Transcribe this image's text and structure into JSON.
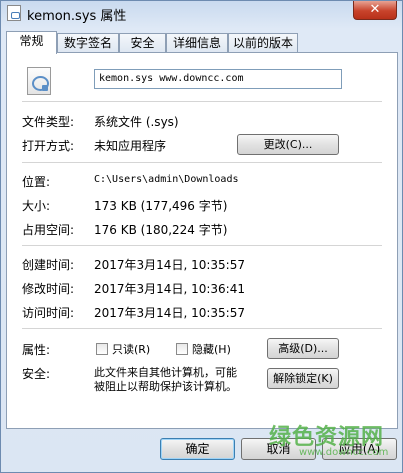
{
  "window": {
    "title": "kemon.sys 属性",
    "close_label": "✕"
  },
  "tabs": [
    {
      "label": "常规",
      "active": true
    },
    {
      "label": "数字签名",
      "active": false
    },
    {
      "label": "安全",
      "active": false
    },
    {
      "label": "详细信息",
      "active": false
    },
    {
      "label": "以前的版本",
      "active": false
    }
  ],
  "general": {
    "file_name": "kemon.sys www.downcc.com",
    "file_type_label": "文件类型:",
    "file_type_value": "系统文件 (.sys)",
    "open_with_label": "打开方式:",
    "open_with_value": "未知应用程序",
    "change_button": "更改(C)...",
    "location_label": "位置:",
    "location_value": "C:\\Users\\admin\\Downloads",
    "size_label": "大小:",
    "size_value": "173 KB (177,496 字节)",
    "disk_size_label": "占用空间:",
    "disk_size_value": "176 KB (180,224 字节)",
    "created_label": "创建时间:",
    "created_value": "2017年3月14日, 10:35:57",
    "modified_label": "修改时间:",
    "modified_value": "2017年3月14日, 10:36:41",
    "accessed_label": "访问时间:",
    "accessed_value": "2017年3月14日, 10:35:57",
    "attributes_label": "属性:",
    "readonly_label": "只读(R)",
    "hidden_label": "隐藏(H)",
    "advanced_button": "高级(D)...",
    "security_label": "安全:",
    "security_text_1": "此文件来自其他计算机，可能",
    "security_text_2": "被阻止以帮助保护该计算机。",
    "unblock_button": "解除锁定(K)"
  },
  "footer": {
    "ok_button": "确定",
    "cancel_button": "取消",
    "apply_button": "应用(A)"
  },
  "watermark": {
    "text": "绿色资源网",
    "url": "www.downcc.com"
  }
}
